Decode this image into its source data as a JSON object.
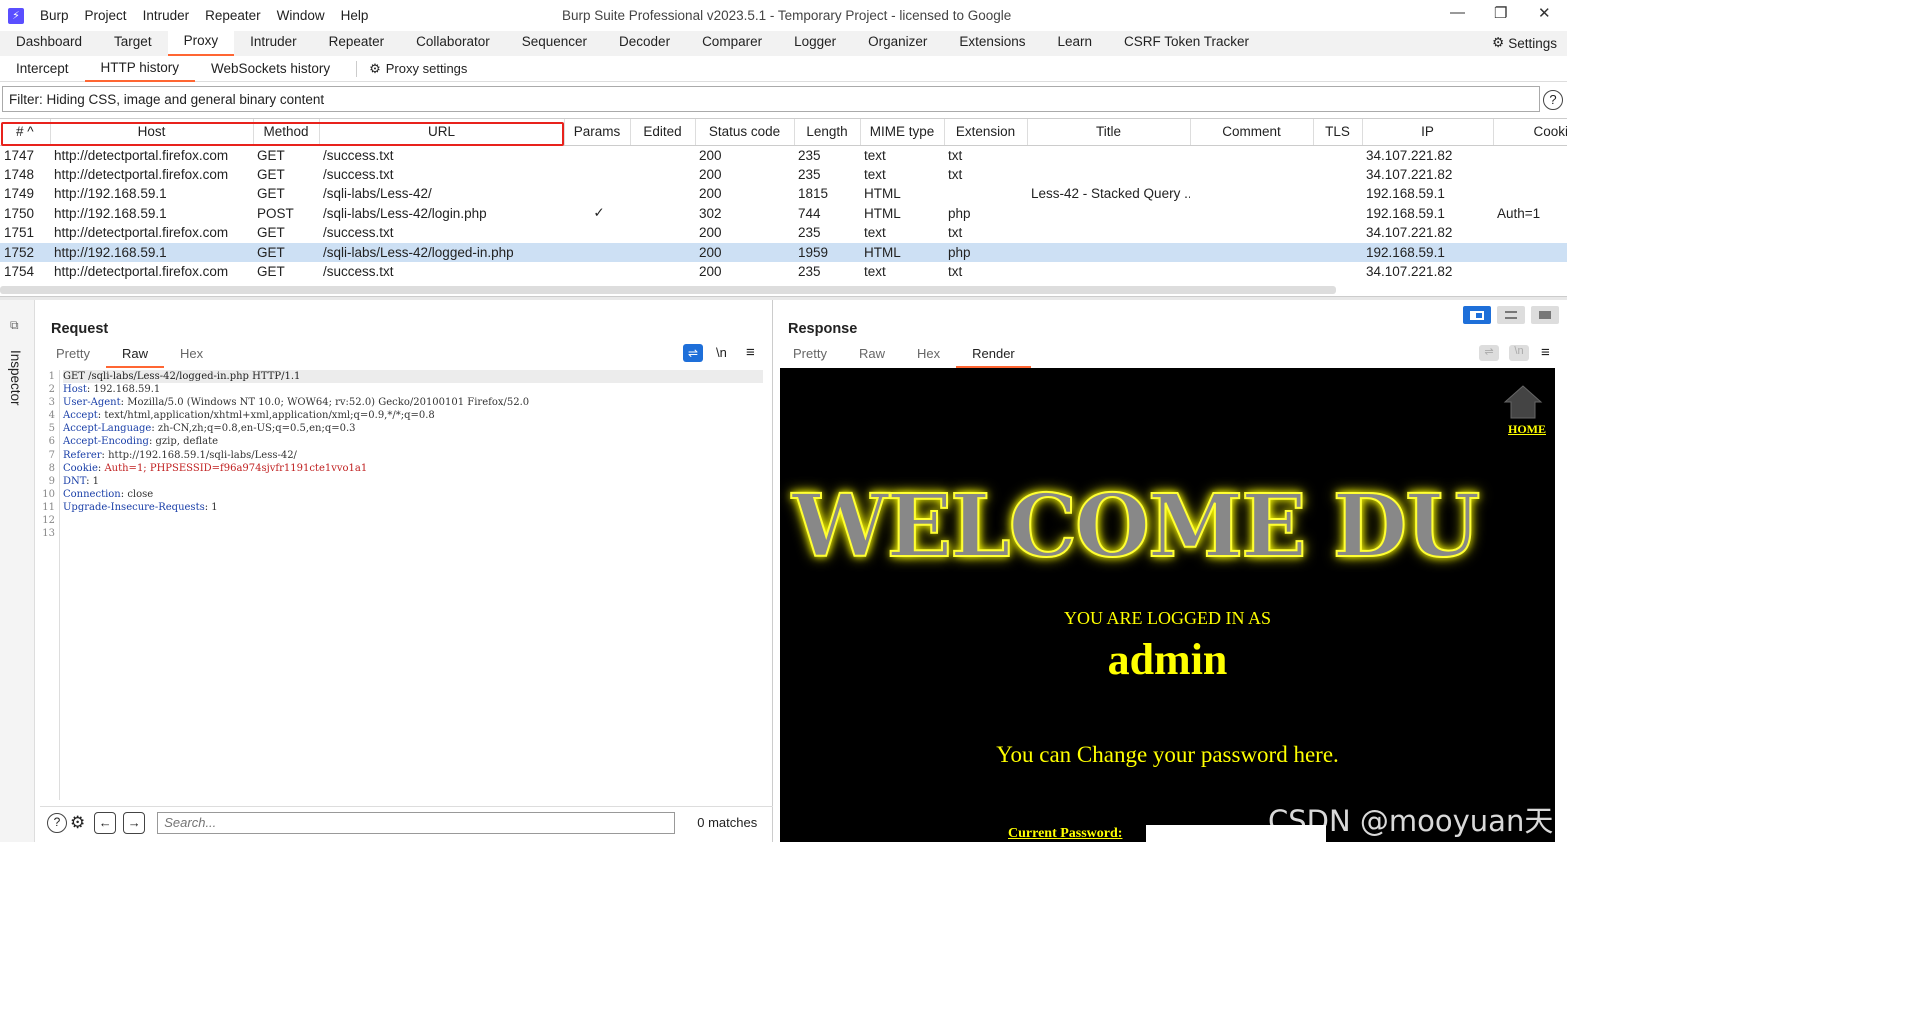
{
  "titlebar": {
    "menu": [
      "Burp",
      "Project",
      "Intruder",
      "Repeater",
      "Window",
      "Help"
    ],
    "title": "Burp Suite Professional v2023.5.1 - Temporary Project - licensed to Google"
  },
  "main_tabs": [
    "Dashboard",
    "Target",
    "Proxy",
    "Intruder",
    "Repeater",
    "Collaborator",
    "Sequencer",
    "Decoder",
    "Comparer",
    "Logger",
    "Organizer",
    "Extensions",
    "Learn",
    "CSRF Token Tracker"
  ],
  "main_tab_active": "Proxy",
  "settings_label": "Settings",
  "sub_tabs": [
    "Intercept",
    "HTTP history",
    "WebSockets history"
  ],
  "sub_tab_active": "HTTP history",
  "proxy_settings_label": "Proxy settings",
  "filter_text": "Filter: Hiding CSS, image and general binary content",
  "history": {
    "columns": [
      "#",
      "Host",
      "Method",
      "URL",
      "Params",
      "Edited",
      "Status code",
      "Length",
      "MIME type",
      "Extension",
      "Title",
      "Comment",
      "TLS",
      "IP",
      "Cookies"
    ],
    "rows": [
      {
        "num": "1747",
        "host": "http://detectportal.firefox.com",
        "method": "GET",
        "url": "/success.txt",
        "params": "",
        "edited": "",
        "status": "200",
        "length": "235",
        "mime": "text",
        "ext": "txt",
        "title": "",
        "comment": "",
        "tls": "",
        "ip": "34.107.221.82",
        "cookies": ""
      },
      {
        "num": "1748",
        "host": "http://detectportal.firefox.com",
        "method": "GET",
        "url": "/success.txt",
        "params": "",
        "edited": "",
        "status": "200",
        "length": "235",
        "mime": "text",
        "ext": "txt",
        "title": "",
        "comment": "",
        "tls": "",
        "ip": "34.107.221.82",
        "cookies": ""
      },
      {
        "num": "1749",
        "host": "http://192.168.59.1",
        "method": "GET",
        "url": "/sqli-labs/Less-42/",
        "params": "",
        "edited": "",
        "status": "200",
        "length": "1815",
        "mime": "HTML",
        "ext": "",
        "title": "Less-42 - Stacked Query ...",
        "comment": "",
        "tls": "",
        "ip": "192.168.59.1",
        "cookies": ""
      },
      {
        "num": "1750",
        "host": "http://192.168.59.1",
        "method": "POST",
        "url": "/sqli-labs/Less-42/login.php",
        "params": "✓",
        "edited": "",
        "status": "302",
        "length": "744",
        "mime": "HTML",
        "ext": "php",
        "title": "",
        "comment": "",
        "tls": "",
        "ip": "192.168.59.1",
        "cookies": "Auth=1"
      },
      {
        "num": "1751",
        "host": "http://detectportal.firefox.com",
        "method": "GET",
        "url": "/success.txt",
        "params": "",
        "edited": "",
        "status": "200",
        "length": "235",
        "mime": "text",
        "ext": "txt",
        "title": "",
        "comment": "",
        "tls": "",
        "ip": "34.107.221.82",
        "cookies": ""
      },
      {
        "num": "1752",
        "host": "http://192.168.59.1",
        "method": "GET",
        "url": "/sqli-labs/Less-42/logged-in.php",
        "params": "",
        "edited": "",
        "status": "200",
        "length": "1959",
        "mime": "HTML",
        "ext": "php",
        "title": "",
        "comment": "",
        "tls": "",
        "ip": "192.168.59.1",
        "cookies": ""
      },
      {
        "num": "1754",
        "host": "http://detectportal.firefox.com",
        "method": "GET",
        "url": "/success.txt",
        "params": "",
        "edited": "",
        "status": "200",
        "length": "235",
        "mime": "text",
        "ext": "txt",
        "title": "",
        "comment": "",
        "tls": "",
        "ip": "34.107.221.82",
        "cookies": ""
      }
    ],
    "selected_row": "1752"
  },
  "inspector_label": "Inspector",
  "request": {
    "title": "Request",
    "tabs": [
      "Pretty",
      "Raw",
      "Hex"
    ],
    "active_tab": "Raw",
    "lines": [
      {
        "k": "",
        "v": "GET /sqli-labs/Less-42/logged-in.php HTTP/1.1"
      },
      {
        "k": "Host",
        "v": "192.168.59.1"
      },
      {
        "k": "User-Agent",
        "v": "Mozilla/5.0 (Windows NT 10.0; WOW64; rv:52.0) Gecko/20100101 Firefox/52.0"
      },
      {
        "k": "Accept",
        "v": "text/html,application/xhtml+xml,application/xml;q=0.9,*/*;q=0.8"
      },
      {
        "k": "Accept-Language",
        "v": "zh-CN,zh;q=0.8,en-US;q=0.5,en;q=0.3"
      },
      {
        "k": "Accept-Encoding",
        "v": "gzip, deflate"
      },
      {
        "k": "Referer",
        "v": "http://192.168.59.1/sqli-labs/Less-42/"
      },
      {
        "k": "Cookie",
        "v": "Auth=1; PHPSESSID=f96a974sjvfr1191cte1vvo1a1"
      },
      {
        "k": "DNT",
        "v": "1"
      },
      {
        "k": "Connection",
        "v": "close"
      },
      {
        "k": "Upgrade-Insecure-Requests",
        "v": "1"
      },
      {
        "k": "",
        "v": ""
      },
      {
        "k": "",
        "v": ""
      }
    ],
    "search_placeholder": "Search...",
    "matches": "0 matches"
  },
  "response": {
    "title": "Response",
    "tabs": [
      "Pretty",
      "Raw",
      "Hex",
      "Render"
    ],
    "active_tab": "Render",
    "render": {
      "home": "HOME",
      "welcome": "WELCOME DU",
      "logged_as": "YOU ARE LOGGED IN AS",
      "user": "admin",
      "change_pw": "You can Change your password here.",
      "current_pw_label": "Current Password:"
    }
  },
  "watermark": "CSDN @mooyuan天天",
  "colors": {
    "accent": "#ff6633",
    "selected_row": "#cde0f4",
    "highlight_box": "#e8221c",
    "render_yellow": "#ffff00"
  }
}
